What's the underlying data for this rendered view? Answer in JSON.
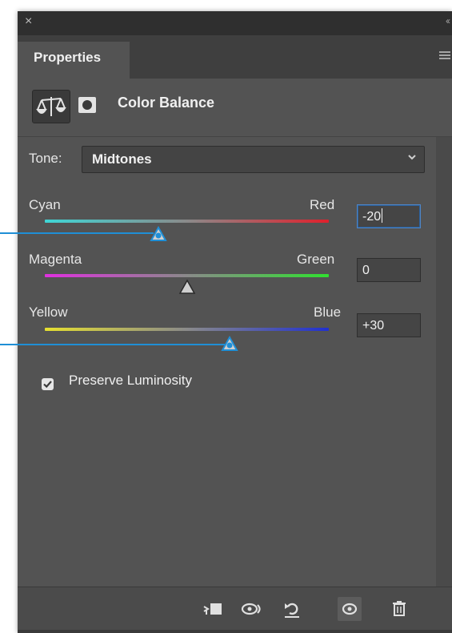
{
  "panel": {
    "tab_label": "Properties",
    "icons": {
      "close": "close-icon",
      "collapse": "collapse-icon",
      "menu": "panel-menu-icon"
    }
  },
  "adjustment": {
    "title": "Color Balance",
    "icons": [
      "color-balance-icon",
      "mask-icon"
    ]
  },
  "tone": {
    "label": "Tone:",
    "value": "Midtones"
  },
  "sliders": [
    {
      "left_label": "Cyan",
      "right_label": "Red",
      "value": "-20",
      "level": -20,
      "left_color": "#3fd6d6",
      "right_color": "#e0202c",
      "active": true
    },
    {
      "left_label": "Magenta",
      "right_label": "Green",
      "value": "0",
      "level": 0,
      "left_color": "#e030e0",
      "right_color": "#30e030",
      "active": false
    },
    {
      "left_label": "Yellow",
      "right_label": "Blue",
      "value": "+30",
      "level": 30,
      "left_color": "#e6e030",
      "right_color": "#2030d0",
      "active": false
    }
  ],
  "slider_range": [
    -100,
    100
  ],
  "preserve_luminosity": {
    "label": "Preserve Luminosity",
    "checked": true
  },
  "footer_icons": [
    "clip-to-layer-icon",
    "view-previous-state-icon",
    "reset-icon",
    "visibility-icon",
    "trash-icon"
  ],
  "colors": {
    "panel_bg": "#535353",
    "accent": "#1f8fd6",
    "highlight_border": "#4f86c6"
  }
}
